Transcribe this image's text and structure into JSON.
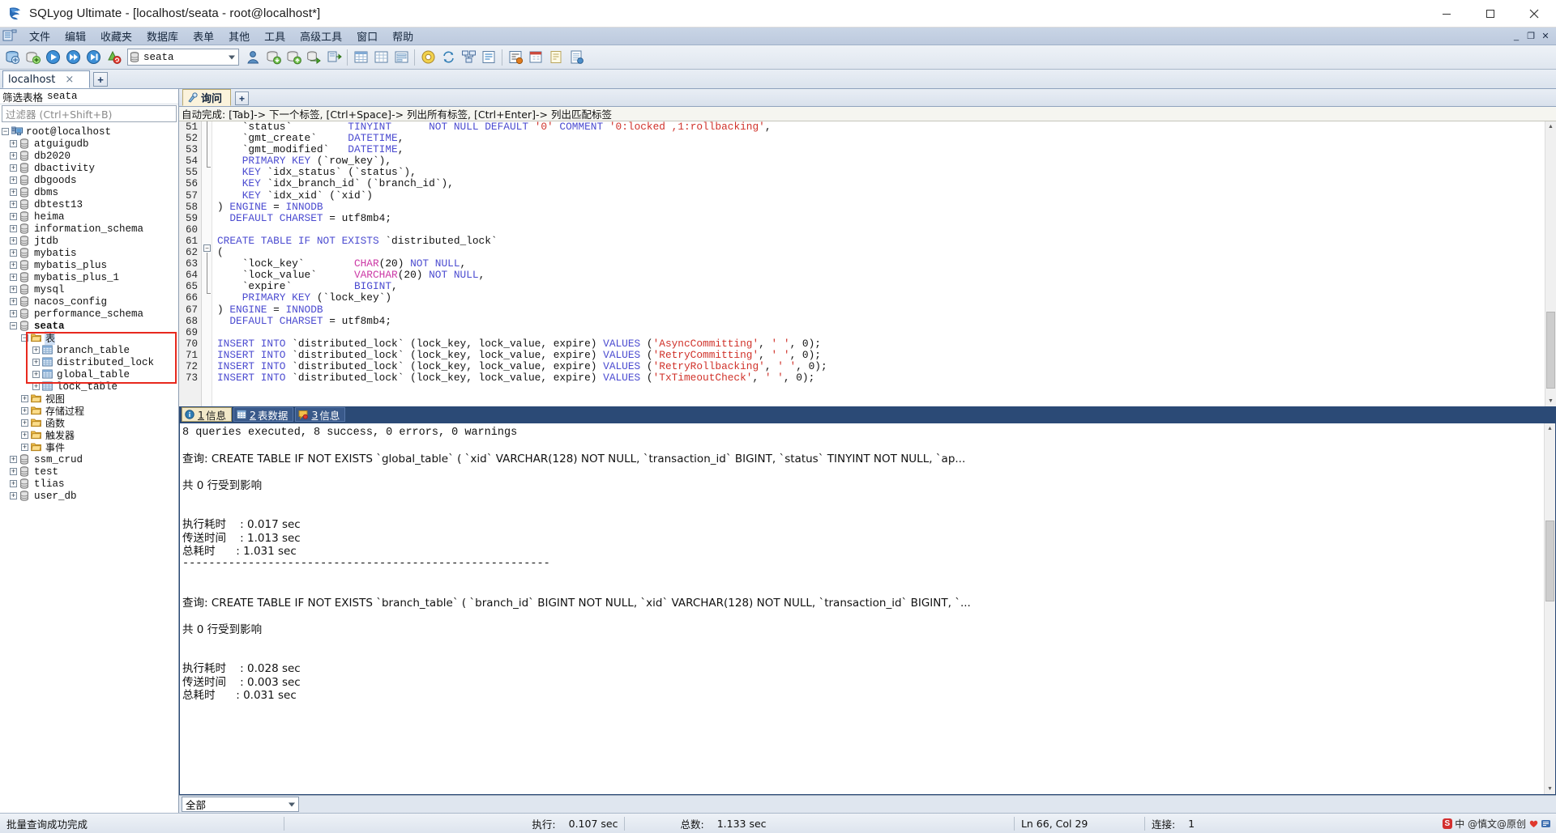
{
  "window": {
    "title": "SQLyog Ultimate - [localhost/seata - root@localhost*]",
    "minimize": "—",
    "maximize": "❐",
    "close": "✕"
  },
  "menubar": {
    "items": [
      "文件",
      "编辑",
      "收藏夹",
      "数据库",
      "表单",
      "其他",
      "工具",
      "高级工具",
      "窗口",
      "帮助"
    ],
    "mdi_buttons": [
      "_",
      "❐",
      "✕"
    ]
  },
  "toolbar": {
    "database_value": "seata",
    "icons": [
      "new-connection-icon",
      "add-connection-icon",
      "execute-query-icon",
      "execute-all-icon",
      "execute-current-icon",
      "refresh-objects-icon",
      "user-manager-icon",
      "backup-database-icon",
      "restore-database-icon",
      "import-external-data-icon",
      "export-data-icon",
      "table-data-icon",
      "grid-view-icon",
      "form-view-icon",
      "copy-database-icon",
      "sync-data-icon",
      "schema-designer-icon",
      "query-builder-icon",
      "sql-formatter-icon",
      "scheduler-icon",
      "notes-icon",
      "html-report-icon",
      "info-icon"
    ]
  },
  "connection_tabs": {
    "tabs": [
      {
        "label": "localhost",
        "close": "×"
      }
    ],
    "add_label": "+"
  },
  "sidebar": {
    "filter_label": "筛选表格",
    "filter_db": "seata",
    "filter_placeholder": "过滤器 (Ctrl+Shift+B)",
    "root": "root@localhost",
    "databases": [
      "atguigudb",
      "db2020",
      "dbactivity",
      "dbgoods",
      "dbms",
      "dbtest13",
      "heima",
      "information_schema",
      "jtdb",
      "mybatis",
      "mybatis_plus",
      "mybatis_plus_1",
      "mysql",
      "nacos_config",
      "performance_schema"
    ],
    "expanded_db": "seata",
    "tables_folder": "表",
    "tables": [
      "branch_table",
      "distributed_lock",
      "global_table",
      "lock_table"
    ],
    "other_folders": [
      "视图",
      "存储过程",
      "函数",
      "触发器",
      "事件"
    ],
    "databases_after": [
      "ssm_crud",
      "test",
      "tlias",
      "user_db"
    ],
    "highlight_color": "#e8291e"
  },
  "query": {
    "tab_label": "询问",
    "add_label": "+",
    "autocomplete_hint": "自动完成: [Tab]-> 下一个标签, [Ctrl+Space]-> 列出所有标签, [Ctrl+Enter]-> 列出匹配标签",
    "first_line_number": 51,
    "lines": [
      {
        "n": 51,
        "tokens": [
          {
            "t": "    `status`         ",
            "c": "pln"
          },
          {
            "t": "TINYINT",
            "c": "kw"
          },
          {
            "t": "      ",
            "c": "pln"
          },
          {
            "t": "NOT NULL DEFAULT ",
            "c": "kw"
          },
          {
            "t": "'0'",
            "c": "str"
          },
          {
            "t": " COMMENT ",
            "c": "kw"
          },
          {
            "t": "'0:locked ,1:rollbacking'",
            "c": "str"
          },
          {
            "t": ",",
            "c": "pln"
          }
        ]
      },
      {
        "n": 52,
        "tokens": [
          {
            "t": "    `gmt_create`     ",
            "c": "pln"
          },
          {
            "t": "DATETIME",
            "c": "kw"
          },
          {
            "t": ",",
            "c": "pln"
          }
        ]
      },
      {
        "n": 53,
        "tokens": [
          {
            "t": "    `gmt_modified`   ",
            "c": "pln"
          },
          {
            "t": "DATETIME",
            "c": "kw"
          },
          {
            "t": ",",
            "c": "pln"
          }
        ]
      },
      {
        "n": 54,
        "tokens": [
          {
            "t": "    PRIMARY KEY ",
            "c": "kw"
          },
          {
            "t": "(`row_key`),",
            "c": "pln"
          }
        ]
      },
      {
        "n": 55,
        "tokens": [
          {
            "t": "    KEY ",
            "c": "kw"
          },
          {
            "t": "`idx_status` (`status`),",
            "c": "pln"
          }
        ]
      },
      {
        "n": 56,
        "tokens": [
          {
            "t": "    KEY ",
            "c": "kw"
          },
          {
            "t": "`idx_branch_id` (`branch_id`),",
            "c": "pln"
          }
        ]
      },
      {
        "n": 57,
        "tokens": [
          {
            "t": "    KEY ",
            "c": "kw"
          },
          {
            "t": "`idx_xid` (`xid`)",
            "c": "pln"
          }
        ]
      },
      {
        "n": 58,
        "tokens": [
          {
            "t": ") ",
            "c": "pln"
          },
          {
            "t": "ENGINE ",
            "c": "kw"
          },
          {
            "t": "= ",
            "c": "pln"
          },
          {
            "t": "INNODB",
            "c": "kw"
          }
        ]
      },
      {
        "n": 59,
        "tokens": [
          {
            "t": "  ",
            "c": "pln"
          },
          {
            "t": "DEFAULT CHARSET ",
            "c": "kw"
          },
          {
            "t": "= utf8mb4;",
            "c": "pln"
          }
        ]
      },
      {
        "n": 60,
        "tokens": []
      },
      {
        "n": 61,
        "tokens": [
          {
            "t": "CREATE TABLE IF NOT EXISTS ",
            "c": "kw"
          },
          {
            "t": "`distributed_lock`",
            "c": "pln"
          }
        ]
      },
      {
        "n": 62,
        "tokens": [
          {
            "t": "(",
            "c": "pln"
          }
        ]
      },
      {
        "n": 63,
        "tokens": [
          {
            "t": "    `lock_key`        ",
            "c": "pln"
          },
          {
            "t": "CHAR",
            "c": "typ"
          },
          {
            "t": "(20) ",
            "c": "pln"
          },
          {
            "t": "NOT NULL",
            "c": "kw"
          },
          {
            "t": ",",
            "c": "pln"
          }
        ]
      },
      {
        "n": 64,
        "tokens": [
          {
            "t": "    `lock_value`      ",
            "c": "pln"
          },
          {
            "t": "VARCHAR",
            "c": "typ"
          },
          {
            "t": "(20) ",
            "c": "pln"
          },
          {
            "t": "NOT NULL",
            "c": "kw"
          },
          {
            "t": ",",
            "c": "pln"
          }
        ]
      },
      {
        "n": 65,
        "tokens": [
          {
            "t": "    `expire`          ",
            "c": "pln"
          },
          {
            "t": "BIGINT",
            "c": "kw"
          },
          {
            "t": ",",
            "c": "pln"
          }
        ]
      },
      {
        "n": 66,
        "tokens": [
          {
            "t": "    PRIMARY KEY ",
            "c": "kw"
          },
          {
            "t": "(`lock_key`)",
            "c": "pln"
          }
        ]
      },
      {
        "n": 67,
        "tokens": [
          {
            "t": ") ",
            "c": "pln"
          },
          {
            "t": "ENGINE ",
            "c": "kw"
          },
          {
            "t": "= ",
            "c": "pln"
          },
          {
            "t": "INNODB",
            "c": "kw"
          }
        ]
      },
      {
        "n": 68,
        "tokens": [
          {
            "t": "  ",
            "c": "pln"
          },
          {
            "t": "DEFAULT CHARSET ",
            "c": "kw"
          },
          {
            "t": "= utf8mb4;",
            "c": "pln"
          }
        ]
      },
      {
        "n": 69,
        "tokens": []
      },
      {
        "n": 70,
        "tokens": [
          {
            "t": "INSERT INTO ",
            "c": "kw"
          },
          {
            "t": "`distributed_lock` ",
            "c": "pln"
          },
          {
            "t": "(lock_key, lock_value, expire) ",
            "c": "pln"
          },
          {
            "t": "VALUES ",
            "c": "kw"
          },
          {
            "t": "(",
            "c": "pln"
          },
          {
            "t": "'AsyncCommitting'",
            "c": "str"
          },
          {
            "t": ", ",
            "c": "pln"
          },
          {
            "t": "' '",
            "c": "str"
          },
          {
            "t": ", 0);",
            "c": "pln"
          }
        ]
      },
      {
        "n": 71,
        "tokens": [
          {
            "t": "INSERT INTO ",
            "c": "kw"
          },
          {
            "t": "`distributed_lock` ",
            "c": "pln"
          },
          {
            "t": "(lock_key, lock_value, expire) ",
            "c": "pln"
          },
          {
            "t": "VALUES ",
            "c": "kw"
          },
          {
            "t": "(",
            "c": "pln"
          },
          {
            "t": "'RetryCommitting'",
            "c": "str"
          },
          {
            "t": ", ",
            "c": "pln"
          },
          {
            "t": "' '",
            "c": "str"
          },
          {
            "t": ", 0);",
            "c": "pln"
          }
        ]
      },
      {
        "n": 72,
        "tokens": [
          {
            "t": "INSERT INTO ",
            "c": "kw"
          },
          {
            "t": "`distributed_lock` ",
            "c": "pln"
          },
          {
            "t": "(lock_key, lock_value, expire) ",
            "c": "pln"
          },
          {
            "t": "VALUES ",
            "c": "kw"
          },
          {
            "t": "(",
            "c": "pln"
          },
          {
            "t": "'RetryRollbacking'",
            "c": "str"
          },
          {
            "t": ", ",
            "c": "pln"
          },
          {
            "t": "' '",
            "c": "str"
          },
          {
            "t": ", 0);",
            "c": "pln"
          }
        ]
      },
      {
        "n": 73,
        "tokens": [
          {
            "t": "INSERT INTO ",
            "c": "kw"
          },
          {
            "t": "`distributed_lock` ",
            "c": "pln"
          },
          {
            "t": "(lock_key, lock_value, expire) ",
            "c": "pln"
          },
          {
            "t": "VALUES ",
            "c": "kw"
          },
          {
            "t": "(",
            "c": "pln"
          },
          {
            "t": "'TxTimeoutCheck'",
            "c": "str"
          },
          {
            "t": ", ",
            "c": "pln"
          },
          {
            "t": "' '",
            "c": "str"
          },
          {
            "t": ", 0);",
            "c": "pln"
          }
        ]
      }
    ]
  },
  "results": {
    "tabs": [
      {
        "num": "1",
        "label": "信息",
        "icon": "info-icon",
        "active": true
      },
      {
        "num": "2",
        "label": "表数据",
        "icon": "grid-icon",
        "active": false
      },
      {
        "num": "3",
        "label": "信息",
        "icon": "message-icon",
        "active": false
      }
    ],
    "lines": [
      "8 queries executed, 8 success, 0 errors, 0 warnings",
      "",
      "查询: CREATE TABLE IF NOT EXISTS `global_table` ( `xid` VARCHAR(128) NOT NULL, `transaction_id` BIGINT, `status` TINYINT NOT NULL, `ap...",
      "",
      "共 0 行受到影响",
      "",
      "",
      "执行耗时    : 0.017 sec",
      "传送时间    : 1.013 sec",
      "总耗时      : 1.031 sec",
      "--------------------------------------------------------",
      "",
      "",
      "查询: CREATE TABLE IF NOT EXISTS `branch_table` ( `branch_id` BIGINT NOT NULL, `xid` VARCHAR(128) NOT NULL, `transaction_id` BIGINT, `...",
      "",
      "共 0 行受到影响",
      "",
      "",
      "执行耗时    : 0.028 sec",
      "传送时间    : 0.003 sec",
      "总耗时      : 0.031 sec"
    ],
    "filter_value": "全部"
  },
  "statusbar": {
    "message": "批量查询成功完成",
    "execute_label": "执行:",
    "execute_value": "0.107 sec",
    "total_label": "总数:",
    "total_value": "1.133 sec",
    "cursor": "Ln 66, Col 29",
    "connection_label": "连接:",
    "connection_value": "1",
    "watermark_logo": "S",
    "watermark_text": "中 @慎文@原创"
  }
}
